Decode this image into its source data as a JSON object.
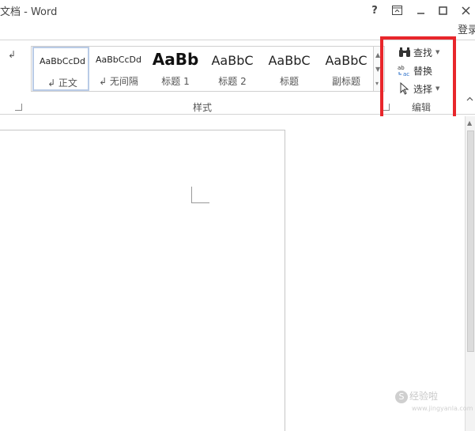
{
  "window": {
    "title": "文档 - Word",
    "login_label": "登录",
    "buttons": {
      "help": "?",
      "ribbon_options": "⧉",
      "minimize": "—",
      "maximize": "☐",
      "close": "✕"
    }
  },
  "ribbon": {
    "paragraph_mark": "↲",
    "styles_group": {
      "label": "样式",
      "tiles": [
        {
          "preview": "AaBbCcDd",
          "label": "↲ 正文",
          "selected": true
        },
        {
          "preview": "AaBbCcDd",
          "label": "↲ 无间隔"
        },
        {
          "preview": "AaBb",
          "label": "标题 1"
        },
        {
          "preview": "AaBbC",
          "label": "标题 2"
        },
        {
          "preview": "AaBbC",
          "label": "标题"
        },
        {
          "preview": "AaBbC",
          "label": "副标题"
        }
      ]
    },
    "editing_group": {
      "label": "编辑",
      "find_label": "查找",
      "replace_label": "替换",
      "select_label": "选择",
      "highlight_color": "#e8262b"
    }
  },
  "watermark": {
    "text": "经验啦",
    "url": "www.jingyanla.com"
  }
}
